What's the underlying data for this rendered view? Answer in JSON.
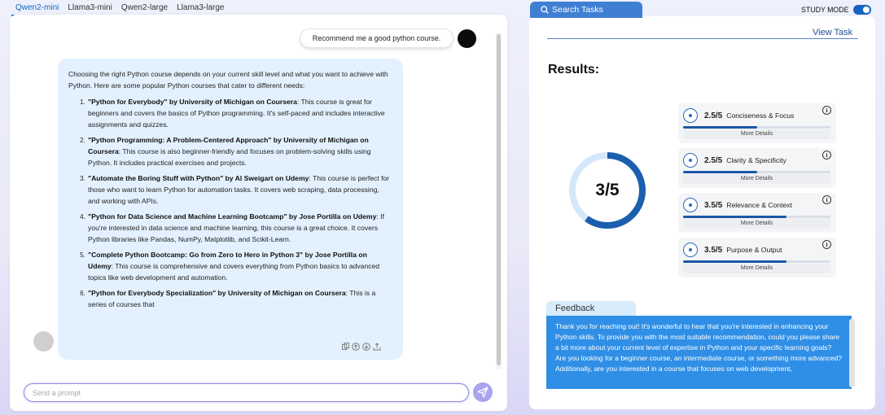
{
  "model_tabs": [
    "Qwen2-mini",
    "Llama3-mini",
    "Qwen2-large",
    "Llama3-large"
  ],
  "chat": {
    "user_message": "Recommend me a good python course.",
    "intro": "Choosing the right Python course depends on your current skill level and what you want to achieve with Python. Here are some popular Python courses that cater to different needs:",
    "courses": [
      {
        "title": "\"Python for Everybody\" by University of Michigan on Coursera",
        "desc": ": This course is great for beginners and covers the basics of Python programming. It's self-paced and includes interactive assignments and quizzes."
      },
      {
        "title": "\"Python Programming: A Problem-Centered Approach\" by University of Michigan on Coursera",
        "desc": ": This course is also beginner-friendly and focuses on problem-solving skills using Python. It includes practical exercises and projects."
      },
      {
        "title": "\"Automate the Boring Stuff with Python\" by Al Sweigart on Udemy",
        "desc": ": This course is perfect for those who want to learn Python for automation tasks. It covers web scraping, data processing, and working with APIs."
      },
      {
        "title": "\"Python for Data Science and Machine Learning Bootcamp\" by Jose Portilla on Udemy",
        "desc": ": If you're interested in data science and machine learning, this course is a great choice. It covers Python libraries like Pandas, NumPy, Matplotlib, and Scikit-Learn."
      },
      {
        "title": "\"Complete Python Bootcamp: Go from Zero to Hero in Python 3\" by Jose Portilla on Udemy",
        "desc": ": This course is comprehensive and covers everything from Python basics to advanced topics like web development and automation."
      },
      {
        "title": "\"Python for Everybody Specialization\" by University of Michigan on Coursera",
        "desc": ": This is a series of courses that"
      }
    ],
    "prompt_placeholder": "Send a prompt",
    "action_icons": [
      "copy-icon",
      "thumbs-up-icon",
      "thumbs-down-icon",
      "share-icon"
    ]
  },
  "right": {
    "search_tab_label": "Search Tasks",
    "study_mode_label": "STUDY MODE",
    "study_mode_on": true,
    "view_task_label": "View Task",
    "results_title": "Results:",
    "overall_score_label": "3/5",
    "overall_score_fraction": 0.6,
    "metrics": [
      {
        "score": "2.5/5",
        "name": "Conciseness & Focus",
        "fraction": 0.5,
        "more": "More Details"
      },
      {
        "score": "2.5/5",
        "name": "Clarity & Specificity",
        "fraction": 0.5,
        "more": "More Details"
      },
      {
        "score": "3.5/5",
        "name": "Relevance & Context",
        "fraction": 0.7,
        "more": "More Details"
      },
      {
        "score": "3.5/5",
        "name": "Purpose & Output",
        "fraction": 0.7,
        "more": "More Details"
      }
    ],
    "feedback_label": "Feedback",
    "feedback_text": "Thank you for reaching out! It's wonderful to hear that you're interested in enhancing your Python skills. To provide you with the most suitable recommendation, could you please share a bit more about your current level of expertise in Python and your specific learning goals? Are you looking for a beginner course, an intermediate course, or something more advanced? Additionally, are you interested in a course that focuses on web development,"
  },
  "colors": {
    "accent": "#1565c0",
    "bubble": "#e2f1fd",
    "feedback_bg": "#2f8fe6"
  }
}
